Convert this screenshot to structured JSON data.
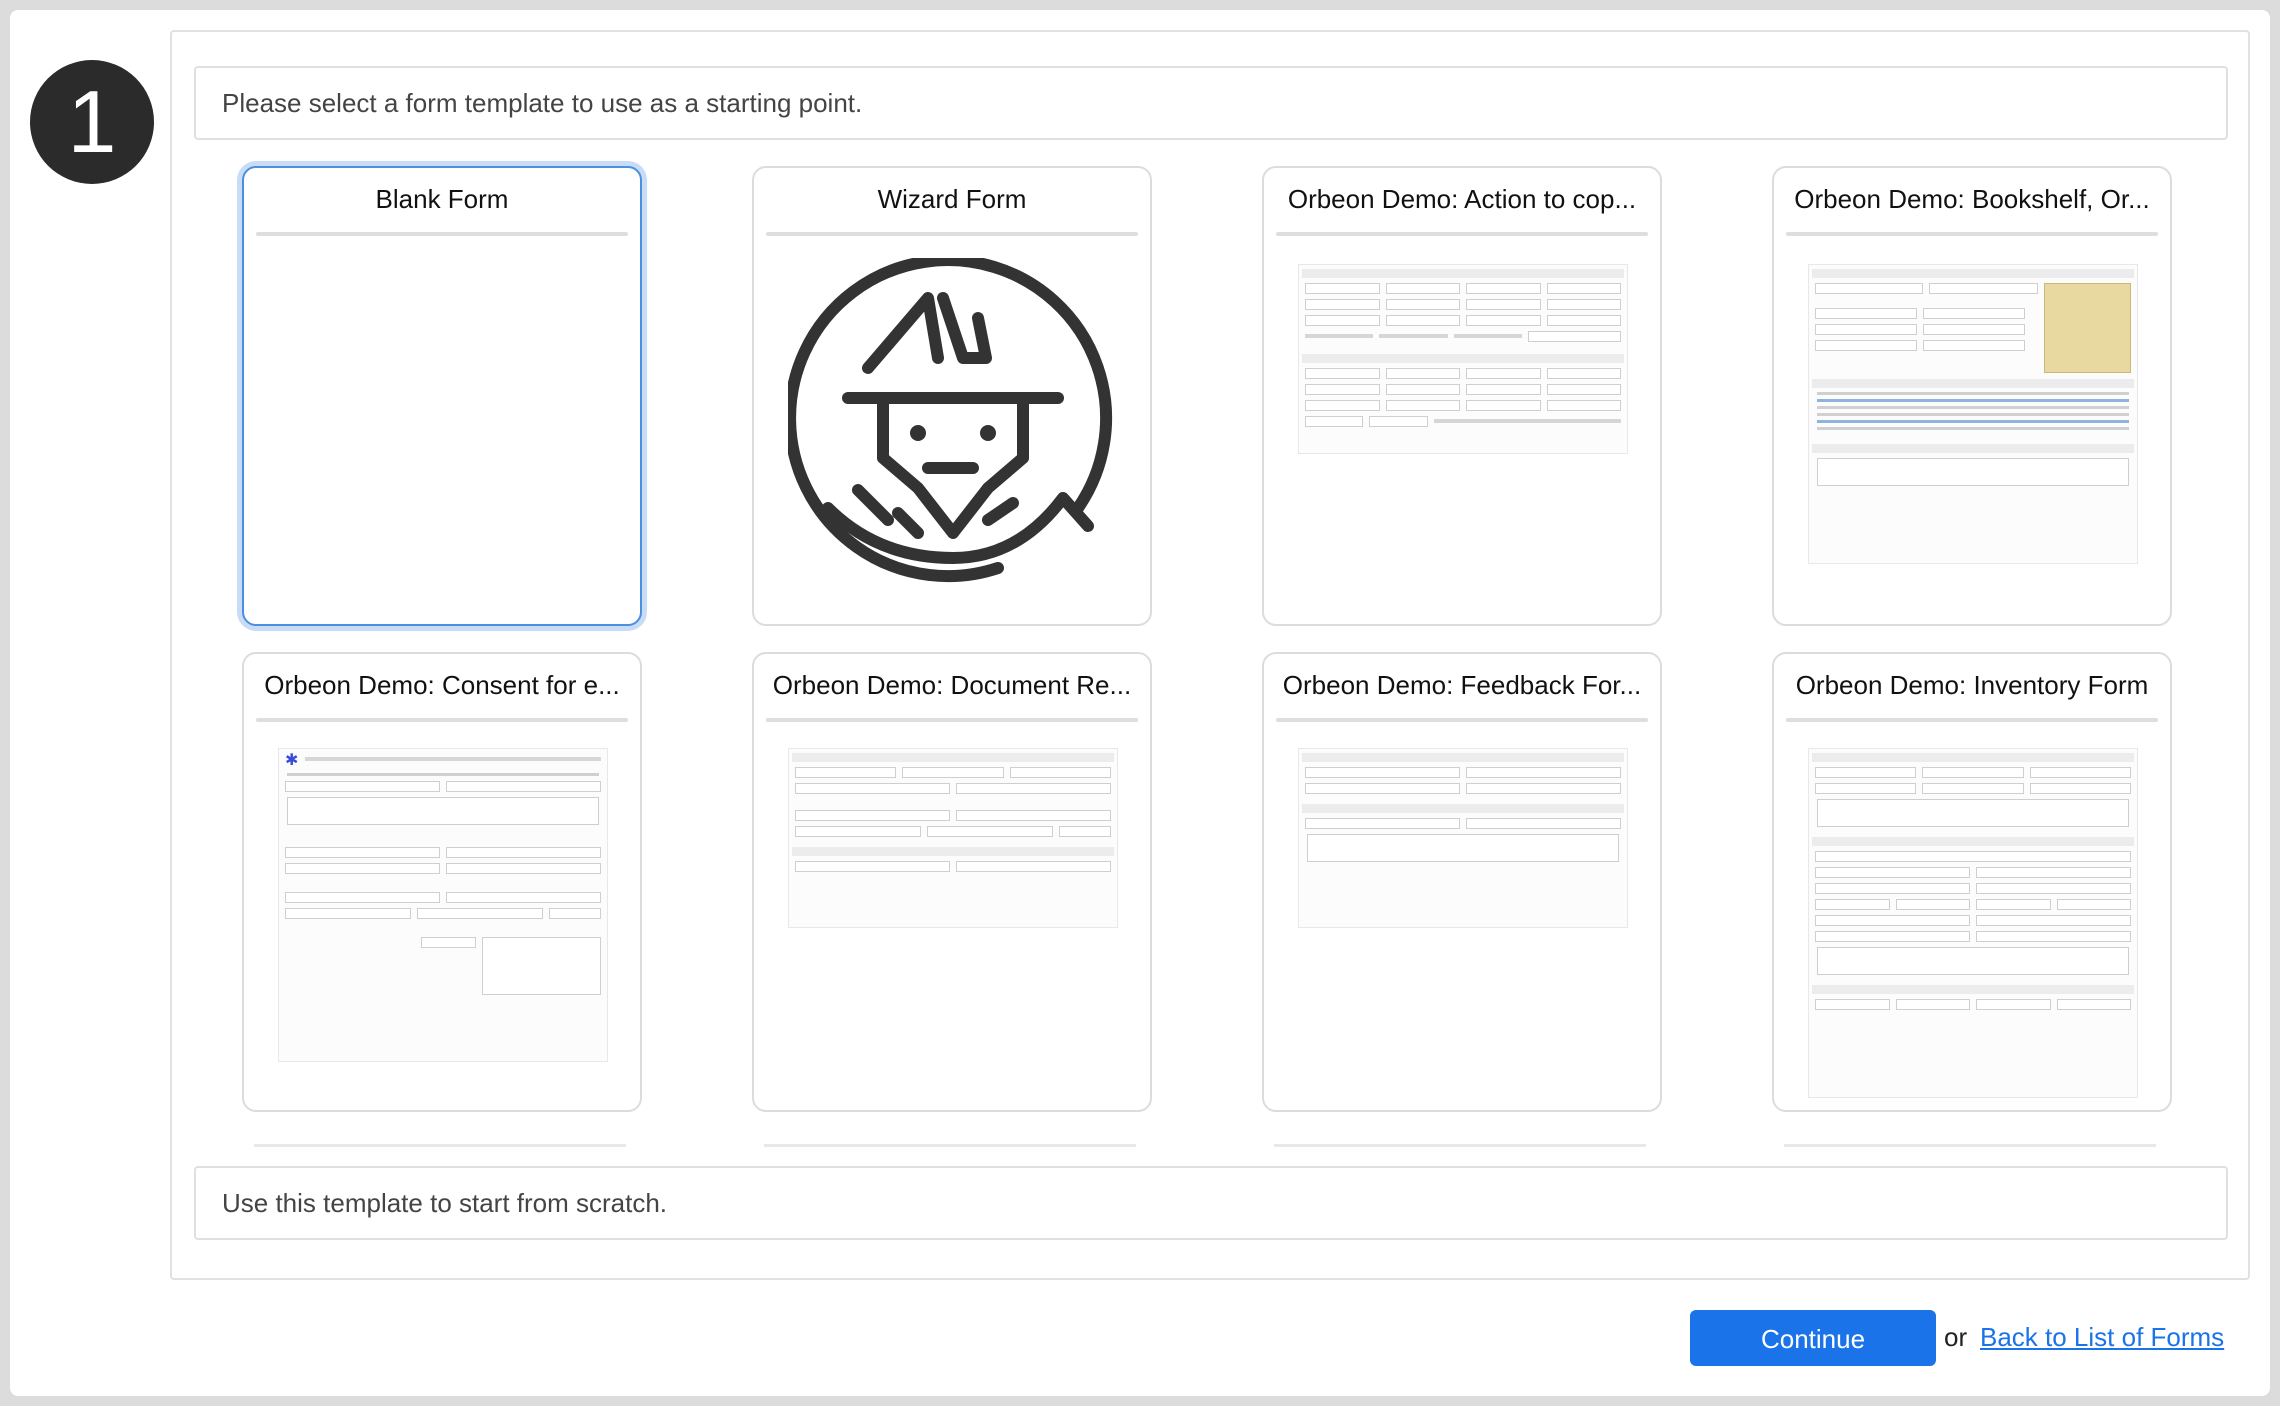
{
  "step": {
    "number": "1"
  },
  "instruction": "Please select a form template to use as a starting point.",
  "description": "Use this template to start from scratch.",
  "templates": [
    {
      "title": "Blank Form",
      "selected": true
    },
    {
      "title": "Wizard Form",
      "selected": false
    },
    {
      "title": "Orbeon Demo: Action to cop...",
      "selected": false
    },
    {
      "title": "Orbeon Demo: Bookshelf, Or...",
      "selected": false
    },
    {
      "title": "Orbeon Demo: Consent for e...",
      "selected": false
    },
    {
      "title": "Orbeon Demo: Document Re...",
      "selected": false
    },
    {
      "title": "Orbeon Demo: Feedback For...",
      "selected": false
    },
    {
      "title": "Orbeon Demo: Inventory Form",
      "selected": false
    }
  ],
  "actions": {
    "continue_label": "Continue",
    "or_label": "or",
    "back_label": "Back to List of Forms"
  },
  "colors": {
    "accent": "#1a73e8",
    "selected_border": "#4a90e2",
    "badge": "#2b2b2b"
  }
}
